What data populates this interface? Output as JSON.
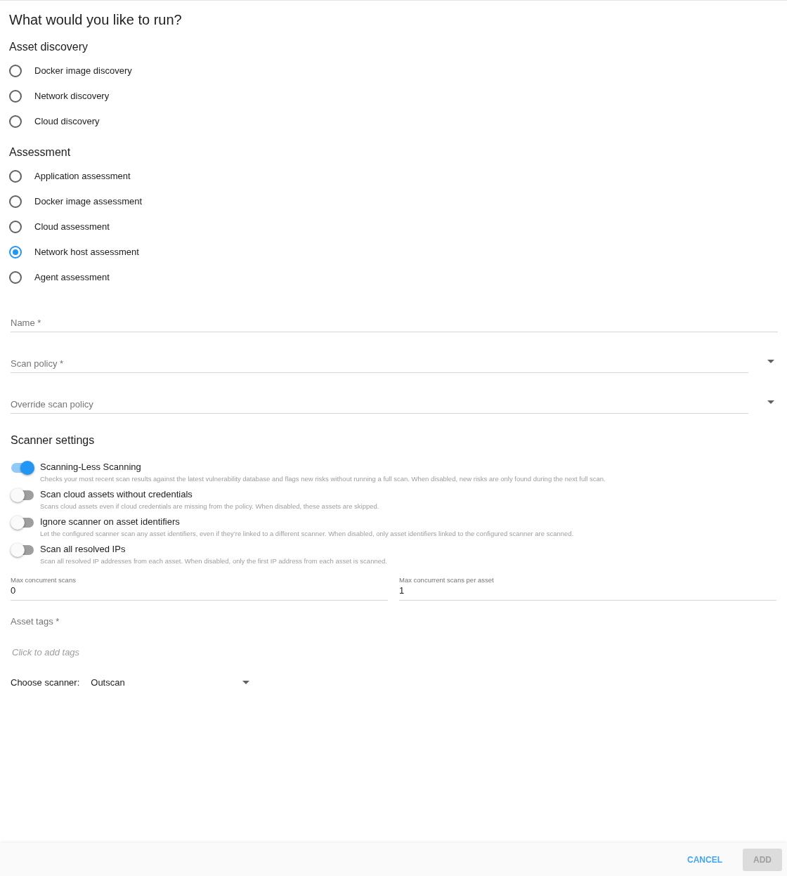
{
  "title": "What would you like to run?",
  "radio_groups": [
    {
      "heading": "Asset discovery",
      "options": [
        {
          "label": "Docker image discovery",
          "selected": false
        },
        {
          "label": "Network discovery",
          "selected": false
        },
        {
          "label": "Cloud discovery",
          "selected": false
        }
      ]
    },
    {
      "heading": "Assessment",
      "options": [
        {
          "label": "Application assessment",
          "selected": false
        },
        {
          "label": "Docker image assessment",
          "selected": false
        },
        {
          "label": "Cloud assessment",
          "selected": false
        },
        {
          "label": "Network host assessment",
          "selected": true
        },
        {
          "label": "Agent assessment",
          "selected": false
        }
      ]
    }
  ],
  "fields": [
    {
      "kind": "text",
      "placeholder": "Name *"
    },
    {
      "kind": "select",
      "placeholder": "Scan policy *"
    },
    {
      "kind": "select",
      "placeholder": "Override scan policy"
    }
  ],
  "scanner_settings": {
    "heading": "Scanner settings",
    "toggles": [
      {
        "label": "Scanning-Less Scanning",
        "description": "Checks your most recent scan results against the latest vulnerability database and flags new risks without running a full scan. When disabled, new risks are only found during the next full scan.",
        "on": true
      },
      {
        "label": "Scan cloud assets without credentials",
        "description": "Scans cloud assets even if cloud credentials are missing from the policy. When disabled, these assets are skipped.",
        "on": false
      },
      {
        "label": "Ignore scanner on asset identifiers",
        "description": "Let the configured scanner scan any asset identifiers, even if they’re linked to a different scanner. When disabled, only asset identifiers linked to the configured scanner are scanned.",
        "on": false
      },
      {
        "label": "Scan all resolved IPs",
        "description": "Scan all resolved IP addresses from each asset. When disabled, only the first IP address from each asset is scanned.",
        "on": false
      }
    ]
  },
  "number_fields": [
    {
      "label": "Max concurrent scans",
      "value": "0"
    },
    {
      "label": "Max concurrent scans per asset",
      "value": "1"
    }
  ],
  "asset_tags": {
    "label": "Asset tags *",
    "placeholder": "Click to add tags"
  },
  "scanner": {
    "label": "Choose scanner:",
    "value": "Outscan"
  },
  "footer": {
    "cancel": "CANCEL",
    "add": {
      "label": "ADD",
      "disabled": true
    }
  }
}
